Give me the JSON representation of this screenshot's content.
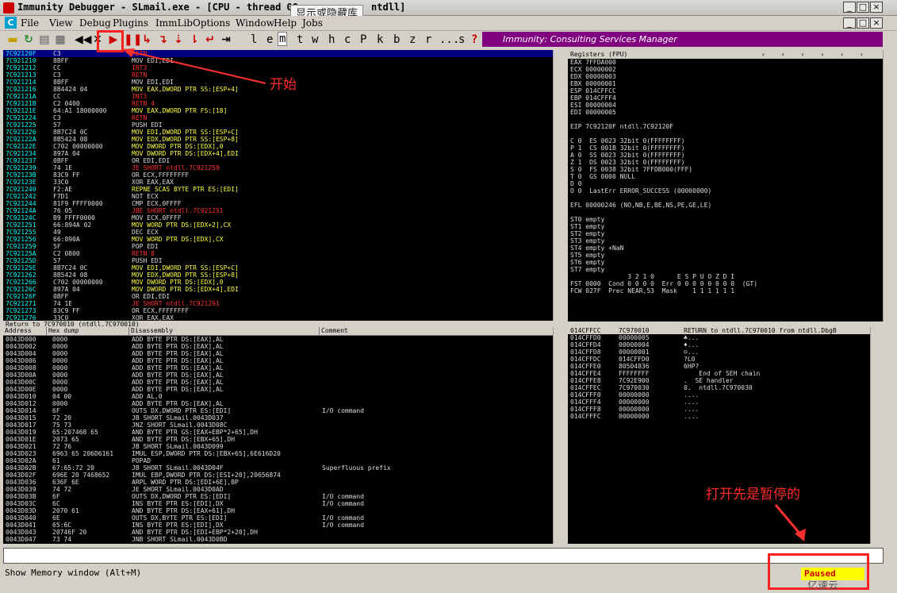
{
  "window": {
    "title": "Immunity Debugger - SLmail.exe - [CPU - thread 00",
    "title_tail": "ntdll]"
  },
  "tooltip": "显示或隐藏库",
  "menu": [
    "File",
    "View",
    "Debug",
    "Plugins",
    "ImmLib",
    "Options",
    "Window",
    "Help",
    "Jobs"
  ],
  "toolbar": {
    "letters": [
      "l",
      "e",
      "m",
      "t",
      "w",
      "h",
      "c",
      "P",
      "k",
      "b",
      "z",
      "r",
      "...",
      "s",
      "?"
    ],
    "banner": "Immunity: Consulting Services Manager"
  },
  "disasm": [
    [
      "7C92120F",
      "C3",
      "RETN",
      ""
    ],
    [
      "7C921210",
      "8BFF",
      "MOV EDI,EDI",
      ""
    ],
    [
      "7C921212",
      "CC",
      "INT3",
      ""
    ],
    [
      "7C921213",
      "C3",
      "RETN",
      ""
    ],
    [
      "7C921214",
      "8BFF",
      "MOV EDI,EDI",
      ""
    ],
    [
      "7C921216",
      "8B4424 04",
      "MOV EAX,DWORD PTR SS:[ESP+4]",
      ""
    ],
    [
      "7C92121A",
      "CC",
      "INT3",
      ""
    ],
    [
      "7C92121B",
      "C2 0400",
      "RETN 4",
      ""
    ],
    [
      "7C92121E",
      "64:A1 18000000",
      "MOV EAX,DWORD PTR FS:[18]",
      ""
    ],
    [
      "7C921224",
      "C3",
      "RETN",
      ""
    ],
    [
      "7C921225",
      "57",
      "PUSH EDI",
      ""
    ],
    [
      "7C921226",
      "8B7C24 0C",
      "MOV EDI,DWORD PTR SS:[ESP+C]",
      ""
    ],
    [
      "7C92122A",
      "8B5424 08",
      "MOV EDX,DWORD PTR SS:[ESP+8]",
      ""
    ],
    [
      "7C92122E",
      "C702 00000000",
      "MOV DWORD PTR DS:[EDX],0",
      ""
    ],
    [
      "7C921234",
      "897A 04",
      "MOV DWORD PTR DS:[EDX+4],EDI",
      ""
    ],
    [
      "7C921237",
      "0BFF",
      "OR EDI,EDI",
      ""
    ],
    [
      "7C921239",
      "74 1E",
      "JE SHORT ntdll.7C921259",
      ""
    ],
    [
      "7C92123B",
      "83C9 FF",
      "OR ECX,FFFFFFFF",
      ""
    ],
    [
      "7C92123E",
      "33C0",
      "XOR EAX,EAX",
      ""
    ],
    [
      "7C921240",
      "F2:AE",
      "REPNE SCAS BYTE PTR ES:[EDI]",
      ""
    ],
    [
      "7C921242",
      "F7D1",
      "NOT ECX",
      ""
    ],
    [
      "7C921244",
      "81F9 FFFF0000",
      "CMP ECX,0FFFF",
      ""
    ],
    [
      "7C92124A",
      "76 05",
      "JBE SHORT ntdll.7C921251",
      ""
    ],
    [
      "7C92124C",
      "B9 FFFF0000",
      "MOV ECX,0FFFF",
      ""
    ],
    [
      "7C921251",
      "66:894A 02",
      "MOV WORD PTR DS:[EDX+2],CX",
      ""
    ],
    [
      "7C921255",
      "49",
      "DEC ECX",
      ""
    ],
    [
      "7C921256",
      "66:890A",
      "MOV WORD PTR DS:[EDX],CX",
      ""
    ],
    [
      "7C921259",
      "5F",
      "POP EDI",
      ""
    ],
    [
      "7C92125A",
      "C2 0800",
      "RETN 8",
      ""
    ],
    [
      "7C92125D",
      "57",
      "PUSH EDI",
      ""
    ],
    [
      "7C92125E",
      "8B7C24 0C",
      "MOV EDI,DWORD PTR SS:[ESP+C]",
      ""
    ],
    [
      "7C921262",
      "8B5424 08",
      "MOV EDX,DWORD PTR SS:[ESP+8]",
      ""
    ],
    [
      "7C921266",
      "C702 00000000",
      "MOV DWORD PTR DS:[EDX],0",
      ""
    ],
    [
      "7C92126C",
      "897A 04",
      "MOV DWORD PTR DS:[EDX+4],EDI",
      ""
    ],
    [
      "7C92126F",
      "0BFF",
      "OR EDI,EDI",
      ""
    ],
    [
      "7C921271",
      "74 1E",
      "JE SHORT ntdll.7C921291",
      ""
    ],
    [
      "7C921273",
      "83C9 FF",
      "OR ECX,FFFFFFFF",
      ""
    ],
    [
      "7C921276",
      "33C0",
      "XOR EAX,EAX",
      ""
    ]
  ],
  "disasm_info": "Return to 7C970010 (ntdll.7C970010)",
  "registers": {
    "header": "Registers (FPU)",
    "lines": [
      "EAX 7FFDA000",
      "ECX 00000002",
      "EDX 00000003",
      "EBX 00000001",
      "ESP 014CFFCC",
      "EBP 014CFFF4",
      "ESI 00000004",
      "EDI 00000005",
      "",
      "EIP 7C92120F ntdll.7C92120F",
      "",
      "C 0  ES 0023 32bit 0(FFFFFFFF)",
      "P 1  CS 001B 32bit 0(FFFFFFFF)",
      "A 0  SS 0023 32bit 0(FFFFFFFF)",
      "Z 1  DS 0023 32bit 0(FFFFFFFF)",
      "S 0  FS 0038 32bit 7FFDB000(FFF)",
      "T 0  GS 0000 NULL",
      "D 0",
      "O 0  LastErr ERROR_SUCCESS (00000000)",
      "",
      "EFL 00000246 (NO,NB,E,BE,NS,PE,GE,LE)",
      "",
      "ST0 empty",
      "ST1 empty",
      "ST2 empty",
      "ST3 empty",
      "ST4 empty +NaN",
      "ST5 empty",
      "ST6 empty",
      "ST7 empty",
      "               3 2 1 0      E S P U O Z D I",
      "FST 0000  Cond 0 0 0 0  Err 0 0 0 0 0 0 0 0  (GT)",
      "FCW 027F  Prec NEAR,53  Mask    1 1 1 1 1 1"
    ]
  },
  "dump": {
    "headers": [
      "Address",
      "Hex dump",
      "Disassembly",
      "Comment"
    ],
    "rows": [
      [
        "0043D000",
        "0000",
        "ADD BYTE PTR DS:[EAX],AL",
        ""
      ],
      [
        "0043D002",
        "0000",
        "ADD BYTE PTR DS:[EAX],AL",
        ""
      ],
      [
        "0043D004",
        "0000",
        "ADD BYTE PTR DS:[EAX],AL",
        ""
      ],
      [
        "0043D006",
        "0000",
        "ADD BYTE PTR DS:[EAX],AL",
        ""
      ],
      [
        "0043D008",
        "0000",
        "ADD BYTE PTR DS:[EAX],AL",
        ""
      ],
      [
        "0043D00A",
        "0000",
        "ADD BYTE PTR DS:[EAX],AL",
        ""
      ],
      [
        "0043D00C",
        "0000",
        "ADD BYTE PTR DS:[EAX],AL",
        ""
      ],
      [
        "0043D00E",
        "0000",
        "ADD BYTE PTR DS:[EAX],AL",
        ""
      ],
      [
        "0043D010",
        "04 00",
        "ADD AL,0",
        ""
      ],
      [
        "0043D012",
        "0000",
        "ADD BYTE PTR DS:[EAX],AL",
        ""
      ],
      [
        "0043D014",
        "6F",
        "OUTS DX,DWORD PTR ES:[EDI]",
        "I/O command"
      ],
      [
        "0043D015",
        "72 20",
        "JB SHORT SLmail.0043D037",
        ""
      ],
      [
        "0043D017",
        "75 73",
        "JNZ SHORT SLmail.0043D08C",
        ""
      ],
      [
        "0043D019",
        "65:207468 65",
        "AND BYTE PTR GS:[EAX+EBP*2+65],DH",
        ""
      ],
      [
        "0043D01E",
        "2073 65",
        "AND BYTE PTR DS:[EBX+65],DH",
        ""
      ],
      [
        "0043D021",
        "72 76",
        "JB SHORT SLmail.0043D099",
        ""
      ],
      [
        "0043D023",
        "6963 65 206D6161",
        "IMUL ESP,DWORD PTR DS:[EBX+65],6E616D20",
        ""
      ],
      [
        "0043D02A",
        "61",
        "POPAD",
        ""
      ],
      [
        "0043D02B",
        "67:65:72 20",
        "JB SHORT SLmail.0043D04F",
        "Superfluous prefix"
      ],
      [
        "0043D02F",
        "696E 20 7468652",
        "IMUL EBP,DWORD PTR DS:[ESI+20],20656874",
        ""
      ],
      [
        "0043D036",
        "636F 6E",
        "ARPL WORD PTR DS:[EDI+6E],BP",
        ""
      ],
      [
        "0043D039",
        "74 72",
        "JE SHORT SLmail.0043D0AD",
        ""
      ],
      [
        "0043D03B",
        "6F",
        "OUTS DX,DWORD PTR ES:[EDI]",
        "I/O command"
      ],
      [
        "0043D03C",
        "6C",
        "INS BYTE PTR ES:[EDI],DX",
        "I/O command"
      ],
      [
        "0043D03D",
        "2070 61",
        "AND BYTE PTR DS:[EAX+61],DH",
        ""
      ],
      [
        "0043D040",
        "6E",
        "OUTS DX,BYTE PTR ES:[EDI]",
        "I/O command"
      ],
      [
        "0043D041",
        "65:6C",
        "INS BYTE PTR ES:[EDI],DX",
        "I/O command"
      ],
      [
        "0043D043",
        "20746F 20",
        "AND BYTE PTR DS:[EDI+EBP*2+20],DH",
        ""
      ],
      [
        "0043D047",
        "73 74",
        "JNB SHORT SLmail.0043D0BD",
        ""
      ]
    ]
  },
  "stack": [
    [
      "014CFFCC",
      "7C970010",
      "RETURN to ntdll.7C970010 from ntdll.DbgB"
    ],
    [
      "014CFFD0",
      "00000005",
      "♣..."
    ],
    [
      "014CFFD4",
      "00000004",
      "♦..."
    ],
    [
      "014CFFD8",
      "00000001",
      "☺..."
    ],
    [
      "014CFFDC",
      "014CFFD0",
      "?L0"
    ],
    [
      "014CFFE0",
      "80504836",
      "6HP?"
    ],
    [
      "014CFFE4",
      "FFFFFFFF",
      "    End of SEH chain"
    ],
    [
      "014CFFE8",
      "7C92E900",
      ".  SE handler"
    ],
    [
      "014CFFEC",
      "7C970030",
      "0.  ntdll.7C970030"
    ],
    [
      "014CFFF0",
      "00000000",
      "...."
    ],
    [
      "014CFFF4",
      "00000000",
      "...."
    ],
    [
      "014CFFF8",
      "00000000",
      "...."
    ],
    [
      "014CFFFC",
      "00000000",
      "...."
    ]
  ],
  "status": {
    "message": "Show Memory window (Alt+M)",
    "state": "Paused"
  },
  "annotations": {
    "start": "开始",
    "paused_note": "打开先是暂停的"
  },
  "watermark": "亿速云",
  "colors": {
    "pane_bg": "#000000",
    "addr_cyan": "#00ffff",
    "red_jump": "#ff3030",
    "yellow_mem": "#ffff40",
    "purple_banner": "#800080",
    "highlight_row": "#000080"
  }
}
